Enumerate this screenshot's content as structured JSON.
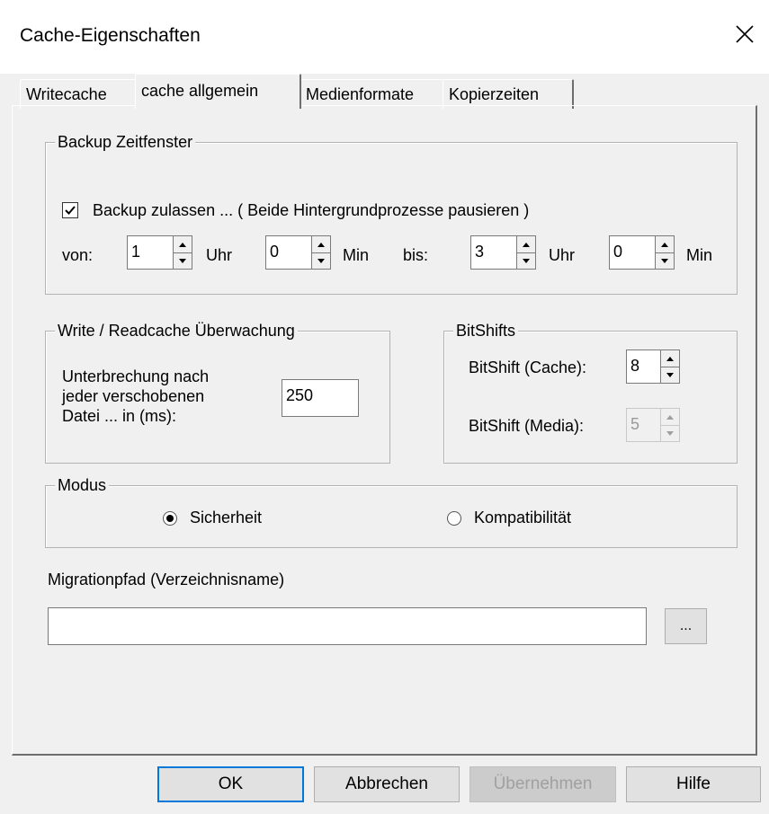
{
  "window": {
    "title": "Cache-Eigenschaften"
  },
  "tabs": [
    "Writecache",
    "cache allgemein",
    "Medienformate",
    "Kopierzeiten"
  ],
  "backup": {
    "group_title": "Backup Zeitfenster",
    "checkbox_label": "Backup zulassen ... ( Beide Hintergrundprozesse pausieren )",
    "checked": true,
    "von_label": "von:",
    "bis_label": "bis:",
    "uhr_label": "Uhr",
    "min_label": "Min",
    "from_hour": "1",
    "from_min": "0",
    "to_hour": "3",
    "to_min": "0"
  },
  "monitor": {
    "group_title": "Write / Readcache Überwachung",
    "line1": "Unterbrechung nach",
    "line2": "jeder verschobenen",
    "line3": "Datei ... in (ms):",
    "value": "250"
  },
  "bitshifts": {
    "group_title": "BitShifts",
    "cache_label": "BitShift (Cache):",
    "cache_value": "8",
    "media_label": "BitShift (Media):",
    "media_value": "5"
  },
  "mode": {
    "group_title": "Modus",
    "option_safety": "Sicherheit",
    "option_compat": "Kompatibilität",
    "selected": "Sicherheit"
  },
  "migration": {
    "label": "Migrationpfad (Verzeichnisname)",
    "value": "",
    "browse_label": "..."
  },
  "buttons": {
    "ok": "OK",
    "cancel": "Abbrechen",
    "apply": "Übernehmen",
    "help": "Hilfe"
  }
}
